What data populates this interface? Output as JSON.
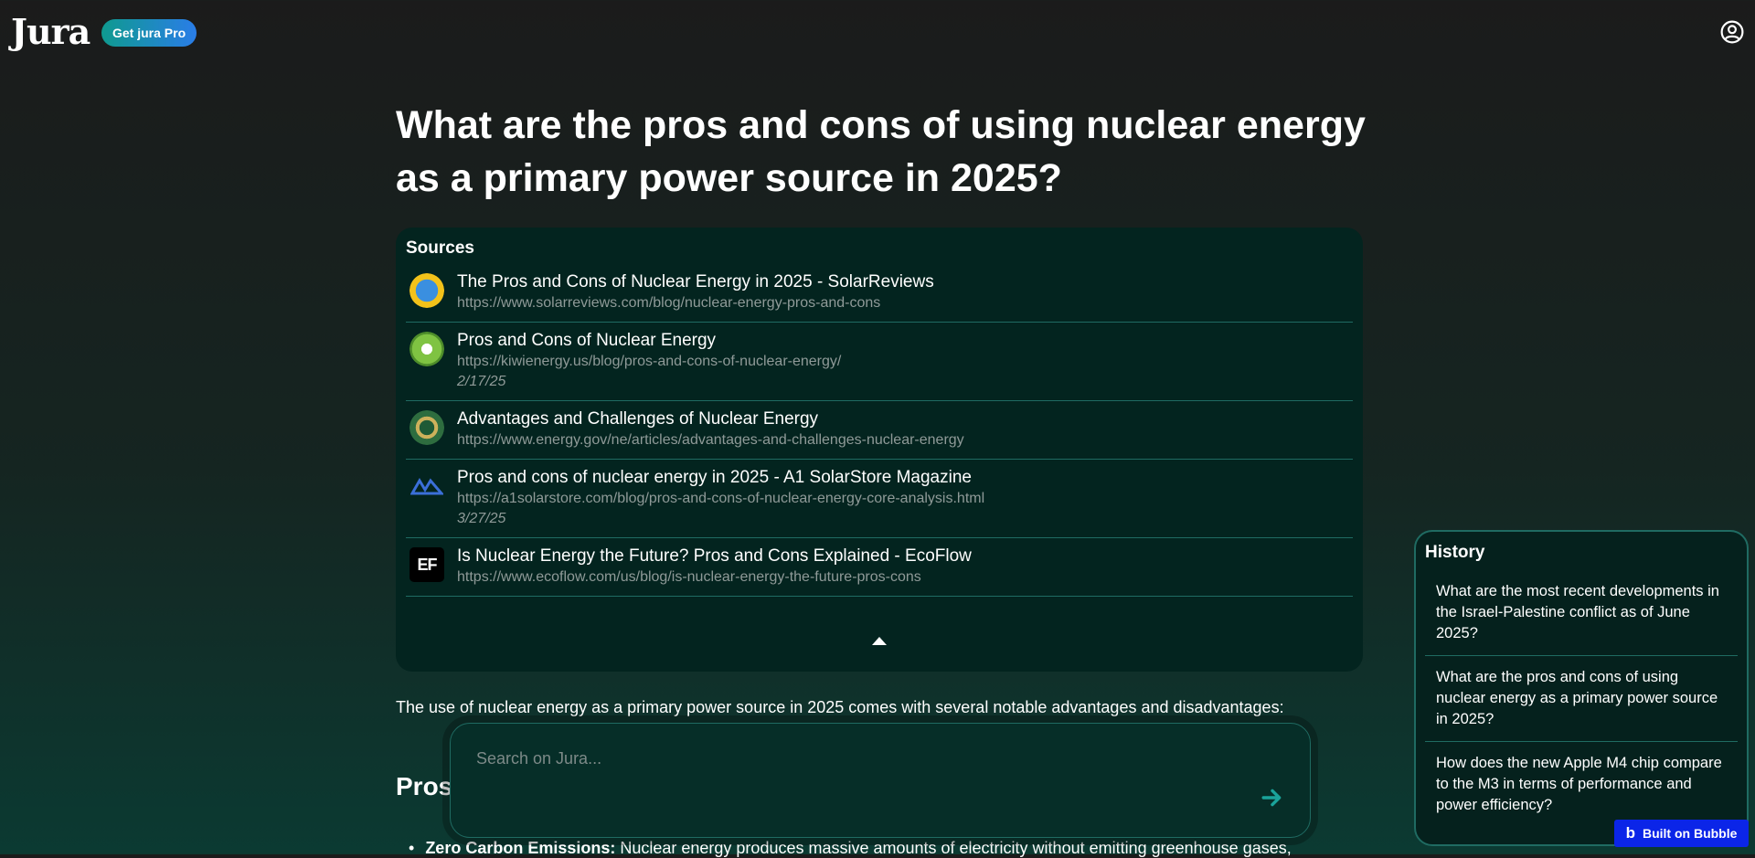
{
  "header": {
    "logo": "Jura",
    "pro_button": "Get jura Pro",
    "account_icon": "user-circle-icon"
  },
  "question": {
    "title": "What are the pros and cons of using nuclear energy as a primary power source in 2025?"
  },
  "sources": {
    "heading": "Sources",
    "items": [
      {
        "title": "The Pros and Cons of Nuclear Energy in 2025 - SolarReviews",
        "url": "https://www.solarreviews.com/blog/nuclear-energy-pros-and-cons",
        "date": "",
        "icon": "solarreviews-favicon"
      },
      {
        "title": "Pros and Cons of Nuclear Energy",
        "url": "https://kiwienergy.us/blog/pros-and-cons-of-nuclear-energy/",
        "date": "2/17/25",
        "icon": "kiwienergy-favicon"
      },
      {
        "title": "Advantages and Challenges of Nuclear Energy",
        "url": "https://www.energy.gov/ne/articles/advantages-and-challenges-nuclear-energy",
        "date": "",
        "icon": "energy-gov-favicon"
      },
      {
        "title": "Pros and cons of nuclear energy in 2025 - A1 SolarStore Magazine",
        "url": "https://a1solarstore.com/blog/pros-and-cons-of-nuclear-energy-core-analysis.html",
        "date": "3/27/25",
        "icon": "a1solarstore-favicon"
      },
      {
        "title": "Is Nuclear Energy the Future? Pros and Cons Explained - EcoFlow",
        "url": "https://www.ecoflow.com/us/blog/is-nuclear-energy-the-future-pros-cons",
        "date": "",
        "icon": "ecoflow-favicon",
        "icon_text": "EF"
      }
    ],
    "collapse_icon": "triangle-up-icon"
  },
  "answer": {
    "intro": "The use of nuclear energy as a primary power source in 2025 comes with several notable advantages and disadvantages:",
    "pros_heading": "Pros",
    "first_bullet_term": "Zero Carbon Emissions:",
    "first_bullet_text": " Nuclear energy produces massive amounts of electricity without emitting greenhouse gases,"
  },
  "search": {
    "placeholder": "Search on Jura...",
    "send_icon": "arrow-right-icon"
  },
  "history": {
    "heading": "History",
    "items": [
      "What are the most recent developments in the Israel-Palestine conflict as of June 2025?",
      "What are the pros and cons of using nuclear energy as a primary power source in 2025?",
      "How does the new Apple M4 chip compare to the M3 in terms of performance and power efficiency?"
    ]
  },
  "badge": {
    "label": "Built on Bubble",
    "icon": "bubble-logo-icon",
    "icon_text": "b"
  },
  "colors": {
    "panel": "#03241f",
    "accent_teal": "#1aa39a",
    "divider": "#1f6b62",
    "bubble_blue": "#0b25e8"
  }
}
